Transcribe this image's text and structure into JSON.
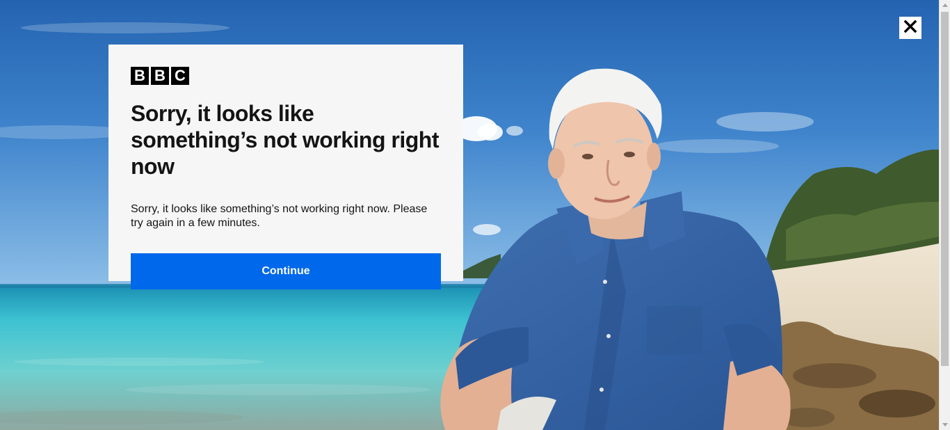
{
  "logo": {
    "letters": [
      "B",
      "B",
      "C"
    ]
  },
  "modal": {
    "title": "Sorry, it looks like something’s not working right now",
    "body": "Sorry, it looks like something’s not working right now. Please try again in a few minutes.",
    "continue_label": "Continue"
  },
  "icons": {
    "close": "close-icon"
  },
  "colors": {
    "button": "#0068ea",
    "modal_background": "#f6f6f6",
    "logo": "#000000"
  }
}
